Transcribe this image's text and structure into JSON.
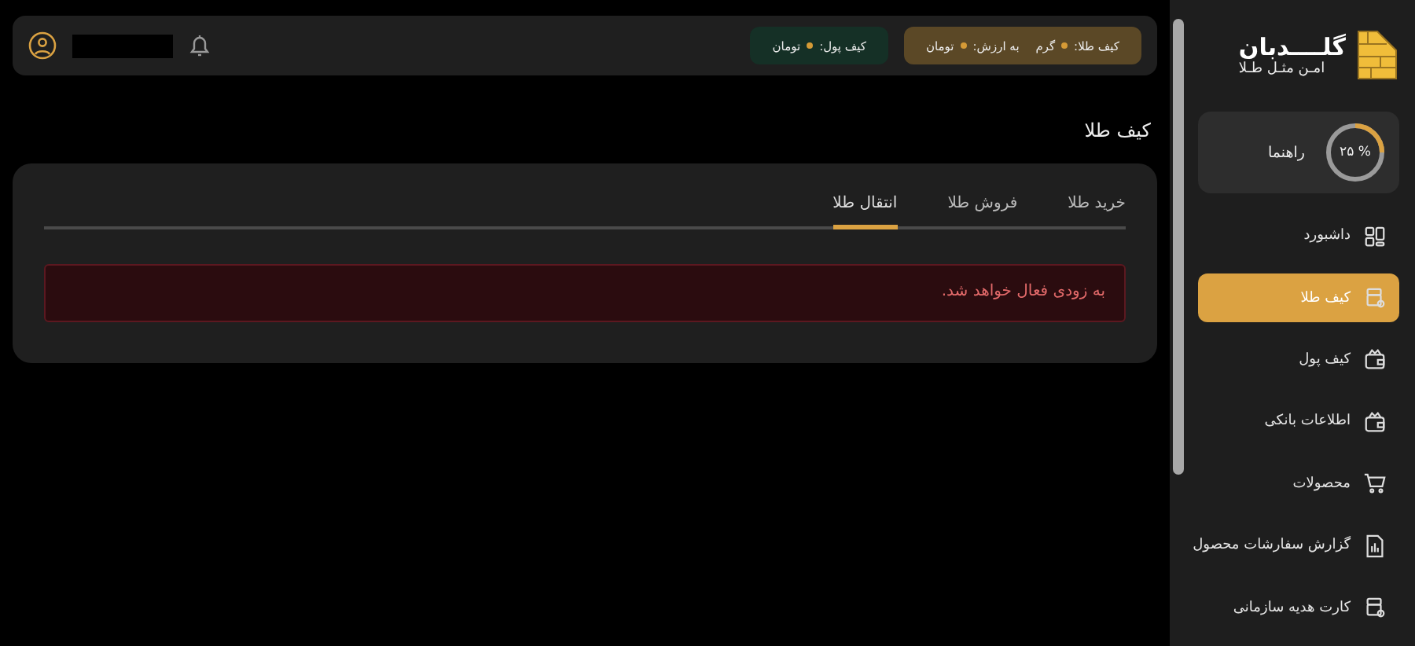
{
  "header": {
    "gold_chip": {
      "label": "کیف طلا:",
      "unit": "گرم",
      "value_label": "به ارزش:",
      "currency": "تومان"
    },
    "cash_chip": {
      "label": "کیف پول:",
      "currency": "تومان"
    }
  },
  "page_title": "کیف طلا",
  "tabs": [
    {
      "label": "خرید طلا",
      "selected": false
    },
    {
      "label": "فروش طلا",
      "selected": false
    },
    {
      "label": "انتقال طلا",
      "selected": true
    }
  ],
  "alert": "به زودی فعال خواهد شد.",
  "sidebar": {
    "logo": {
      "name": "گلــــدبان",
      "tagline": "امـن مثـل طـلا"
    },
    "guide": {
      "label": "راهنما",
      "percent": "۲۵ %",
      "level": 0.25
    },
    "items": [
      {
        "label": "داشبورد",
        "kind": "dashboard",
        "selected": false
      },
      {
        "label": "کیف طلا",
        "kind": "gold",
        "selected": true
      },
      {
        "label": "کیف پول",
        "kind": "wallet",
        "selected": false
      },
      {
        "label": "اطلاعات بانکی",
        "kind": "wallet",
        "selected": false
      },
      {
        "label": "محصولات",
        "kind": "cart",
        "selected": false
      },
      {
        "label": "گزارش سفارشات محصول",
        "kind": "report",
        "selected": false
      },
      {
        "label": "کارت هدیه سازمانی",
        "kind": "gold",
        "selected": false
      }
    ]
  }
}
